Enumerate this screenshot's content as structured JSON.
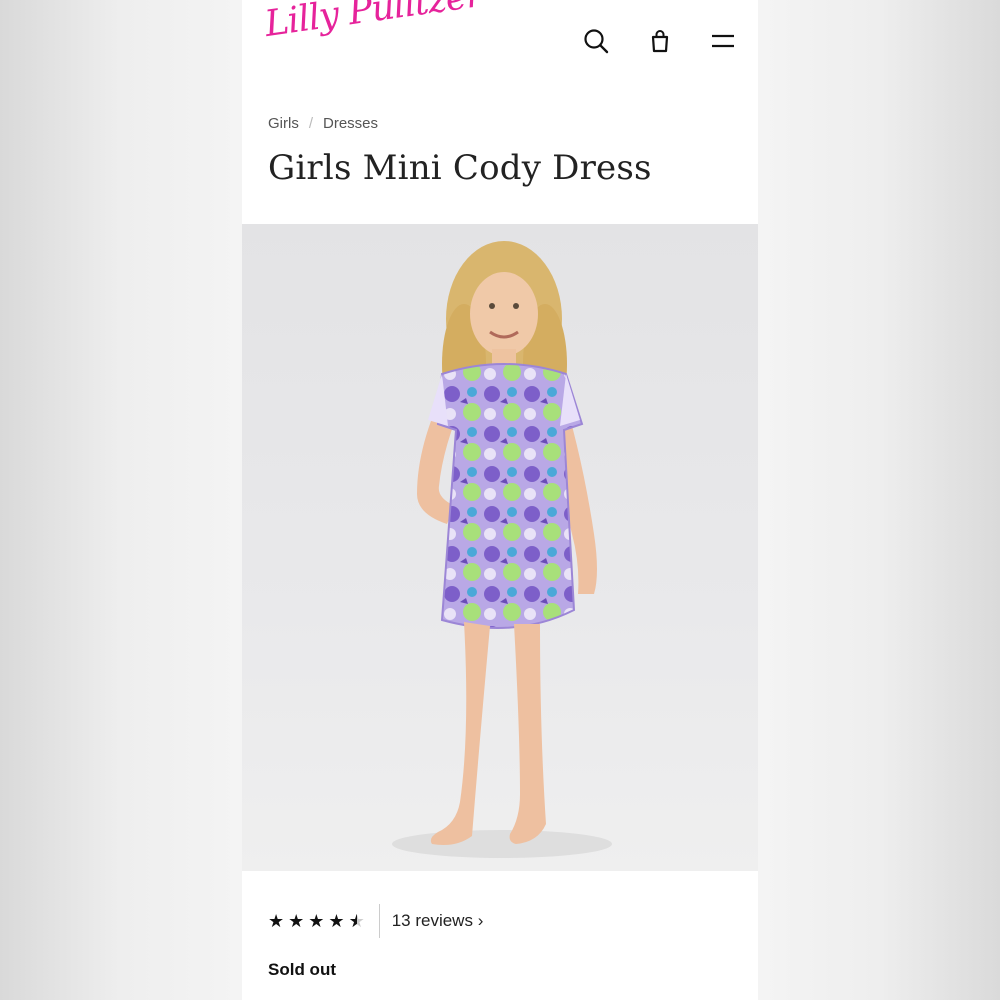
{
  "brand": {
    "logo_text": "Lilly Pulitzer",
    "color": "#e6239b"
  },
  "header": {
    "icons": [
      "search-icon",
      "shopping-bag-icon",
      "menu-icon"
    ]
  },
  "breadcrumb": {
    "items": [
      "Girls",
      "Dresses"
    ],
    "separator": "/"
  },
  "product": {
    "title": "Girls Mini Cody Dress",
    "rating": 4.5,
    "reviews_label": "13 reviews",
    "reviews_chevron": "›",
    "availability": "Sold out"
  }
}
